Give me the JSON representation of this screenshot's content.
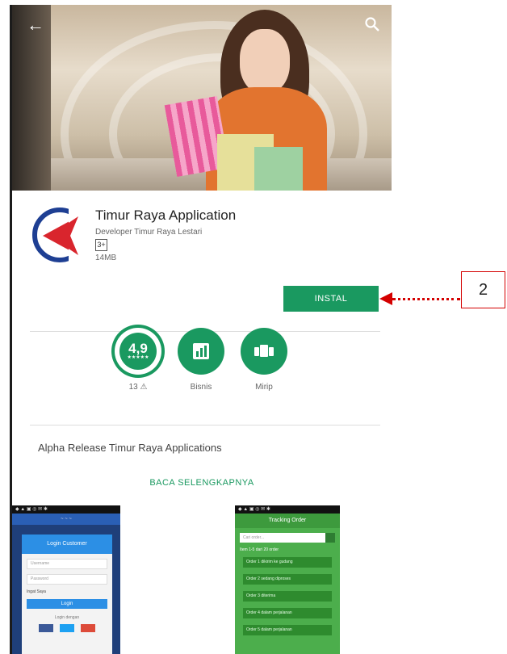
{
  "app": {
    "title": "Timur Raya Application",
    "developer": "Developer Timur Raya Lestari",
    "content_rating_badge": "3+",
    "size": "14MB",
    "install_label": "INSTAL"
  },
  "stats": [
    {
      "value": "4,9",
      "stars": "★★★★★",
      "label": "13 ⚠",
      "icon": "rating-badge"
    },
    {
      "value": "",
      "label": "Bisnis",
      "icon": "chart-icon"
    },
    {
      "value": "",
      "label": "Mirip",
      "icon": "similar-apps-icon"
    }
  ],
  "description": "Alpha Release Timur Raya Applications",
  "read_more": "BACA SELENGKAPNYA",
  "screenshots": {
    "login": {
      "status": "◆ ▲ ▣ ◎ ✉ ✱",
      "nav": "~ ~ ~",
      "header": "Login Customer",
      "field1": "Username",
      "field2": "Password",
      "remember": "Ingat Saya",
      "button": "Login",
      "separator": "Login dengan",
      "social_colors": [
        "#3b5998",
        "#1da1f2",
        "#dd4b39"
      ]
    },
    "tracking": {
      "status": "◆ ▲ ▣ ◎ ✉ ✱",
      "header": "Tracking Order",
      "search_placeholder": "Cari order...",
      "pager": "Item 1-5 dari 20 order",
      "rows": [
        "Order 1 dikirim ke gudang",
        "Order 2 sedang diproses",
        "Order 3 diterima",
        "Order 4 dalam perjalanan",
        "Order 5 dalam perjalanan"
      ]
    }
  },
  "annotation": {
    "number": "2"
  },
  "colors": {
    "accent": "#1a9960",
    "annotation": "#d40000"
  }
}
